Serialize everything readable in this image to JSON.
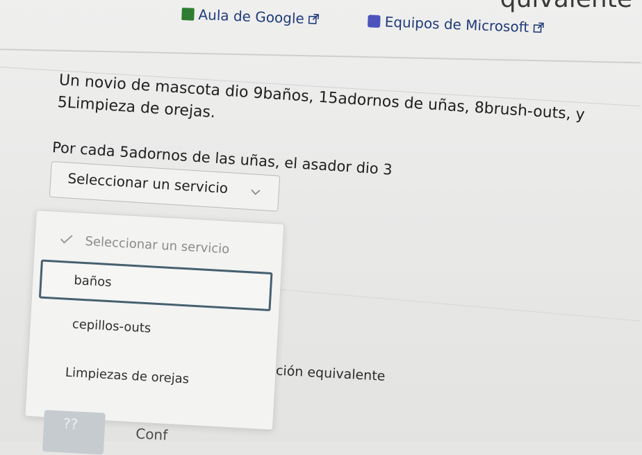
{
  "header": {
    "partial_title": "quivalente",
    "links": [
      {
        "label": "Aula de Google",
        "icon": "google-classroom-icon"
      },
      {
        "label": "Equipos de Microsoft",
        "icon": "microsoft-teams-icon"
      }
    ]
  },
  "question": {
    "line1": "Un novio de mascota dio 9baños, 15adornos de uñas, 8brush-outs, y",
    "line2": "5Limpieza de orejas."
  },
  "prompt": {
    "text": "Por cada 5adornos de las uñas, el asador dio 3"
  },
  "select": {
    "value": "Seleccionar un servicio",
    "trailing": "."
  },
  "dropdown": {
    "options": [
      {
        "label": "Seleccionar un servicio",
        "state": "placeholder"
      },
      {
        "label": "baños",
        "state": "highlighted"
      },
      {
        "label": "cepillos-outs",
        "state": "normal"
      },
      {
        "label": "Limpiezas de orejas",
        "state": "normal"
      }
    ]
  },
  "behind": {
    "text": "ación equivalente"
  },
  "bottom": {
    "button_label": "??",
    "cut_text": "Conf"
  }
}
